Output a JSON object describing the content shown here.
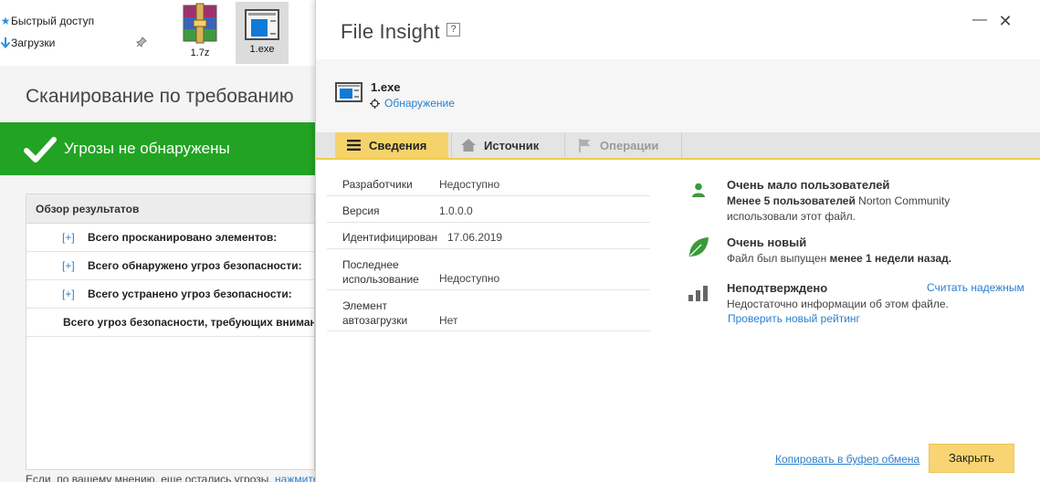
{
  "explorer": {
    "nav": [
      {
        "label": "Быстрый доступ",
        "icon": "star-icon"
      },
      {
        "label": "Загрузки",
        "icon": "download-arrow-icon"
      }
    ],
    "files": [
      {
        "name": "1.7z",
        "icon": "winrar-archive-icon"
      },
      {
        "name": "1.exe",
        "icon": "executable-window-icon"
      }
    ]
  },
  "scan": {
    "title": "Сканирование по требованию",
    "status": "Угрозы не обнаружены",
    "results_header": "Обзор результатов",
    "rows": [
      {
        "expander": "[+]",
        "label": "Всего просканировано элементов:"
      },
      {
        "expander": "[+]",
        "label": "Всего обнаружено угроз безопасности:"
      },
      {
        "expander": "[+]",
        "label": "Всего устранено угроз безопасности:"
      },
      {
        "expander": "",
        "label": "Всего угроз безопасности, требующих внимания:"
      }
    ],
    "footer_text": "Если, по вашему мнению, еще остались угрозы, ",
    "footer_link": "нажмите"
  },
  "insight": {
    "title": "File Insight",
    "help": "?",
    "minimize": "—",
    "close": "✕",
    "file_name": "1.exe",
    "detection_label": "Обнаружение",
    "tabs": [
      {
        "label": "Сведения",
        "icon": "list-icon",
        "state": "active"
      },
      {
        "label": "Источник",
        "icon": "home-icon",
        "state": "normal"
      },
      {
        "label": "Операции",
        "icon": "flag-icon",
        "state": "disabled"
      }
    ],
    "details": {
      "developers": {
        "key": "Разработчики",
        "value": "Недоступно"
      },
      "version": {
        "key": "Версия",
        "value": "1.0.0.0"
      },
      "identified": {
        "key": "Идентифицирован",
        "value": "17.06.2019"
      },
      "last_used": {
        "key1": "Последнее",
        "key2": "использование",
        "value": "Недоступно"
      },
      "autostart": {
        "key1": "Элемент",
        "key2": "автозагрузки",
        "value": "Нет"
      }
    },
    "users": {
      "title": "Очень мало пользователей",
      "line1_bold": "Менее 5 пользователей",
      "line1_rest": " Norton Community",
      "line2": "использовали этот файл."
    },
    "age": {
      "title": "Очень новый",
      "line1_pre": "Файл был выпущен ",
      "line1_bold": "менее 1 недели назад."
    },
    "trust": {
      "title": "Неподтверждено",
      "action": "Считать надежным",
      "line1": "Недостаточно информации об этом файле.",
      "rating_link": "Проверить новый рейтинг"
    },
    "copy_link": "Копировать в буфер обмена",
    "close_button": "Закрыть"
  },
  "colors": {
    "status_green": "#23a323",
    "accent_yellow": "#f6d36a",
    "link_blue": "#2b7fcf",
    "norton_green": "#3a9a3a"
  }
}
